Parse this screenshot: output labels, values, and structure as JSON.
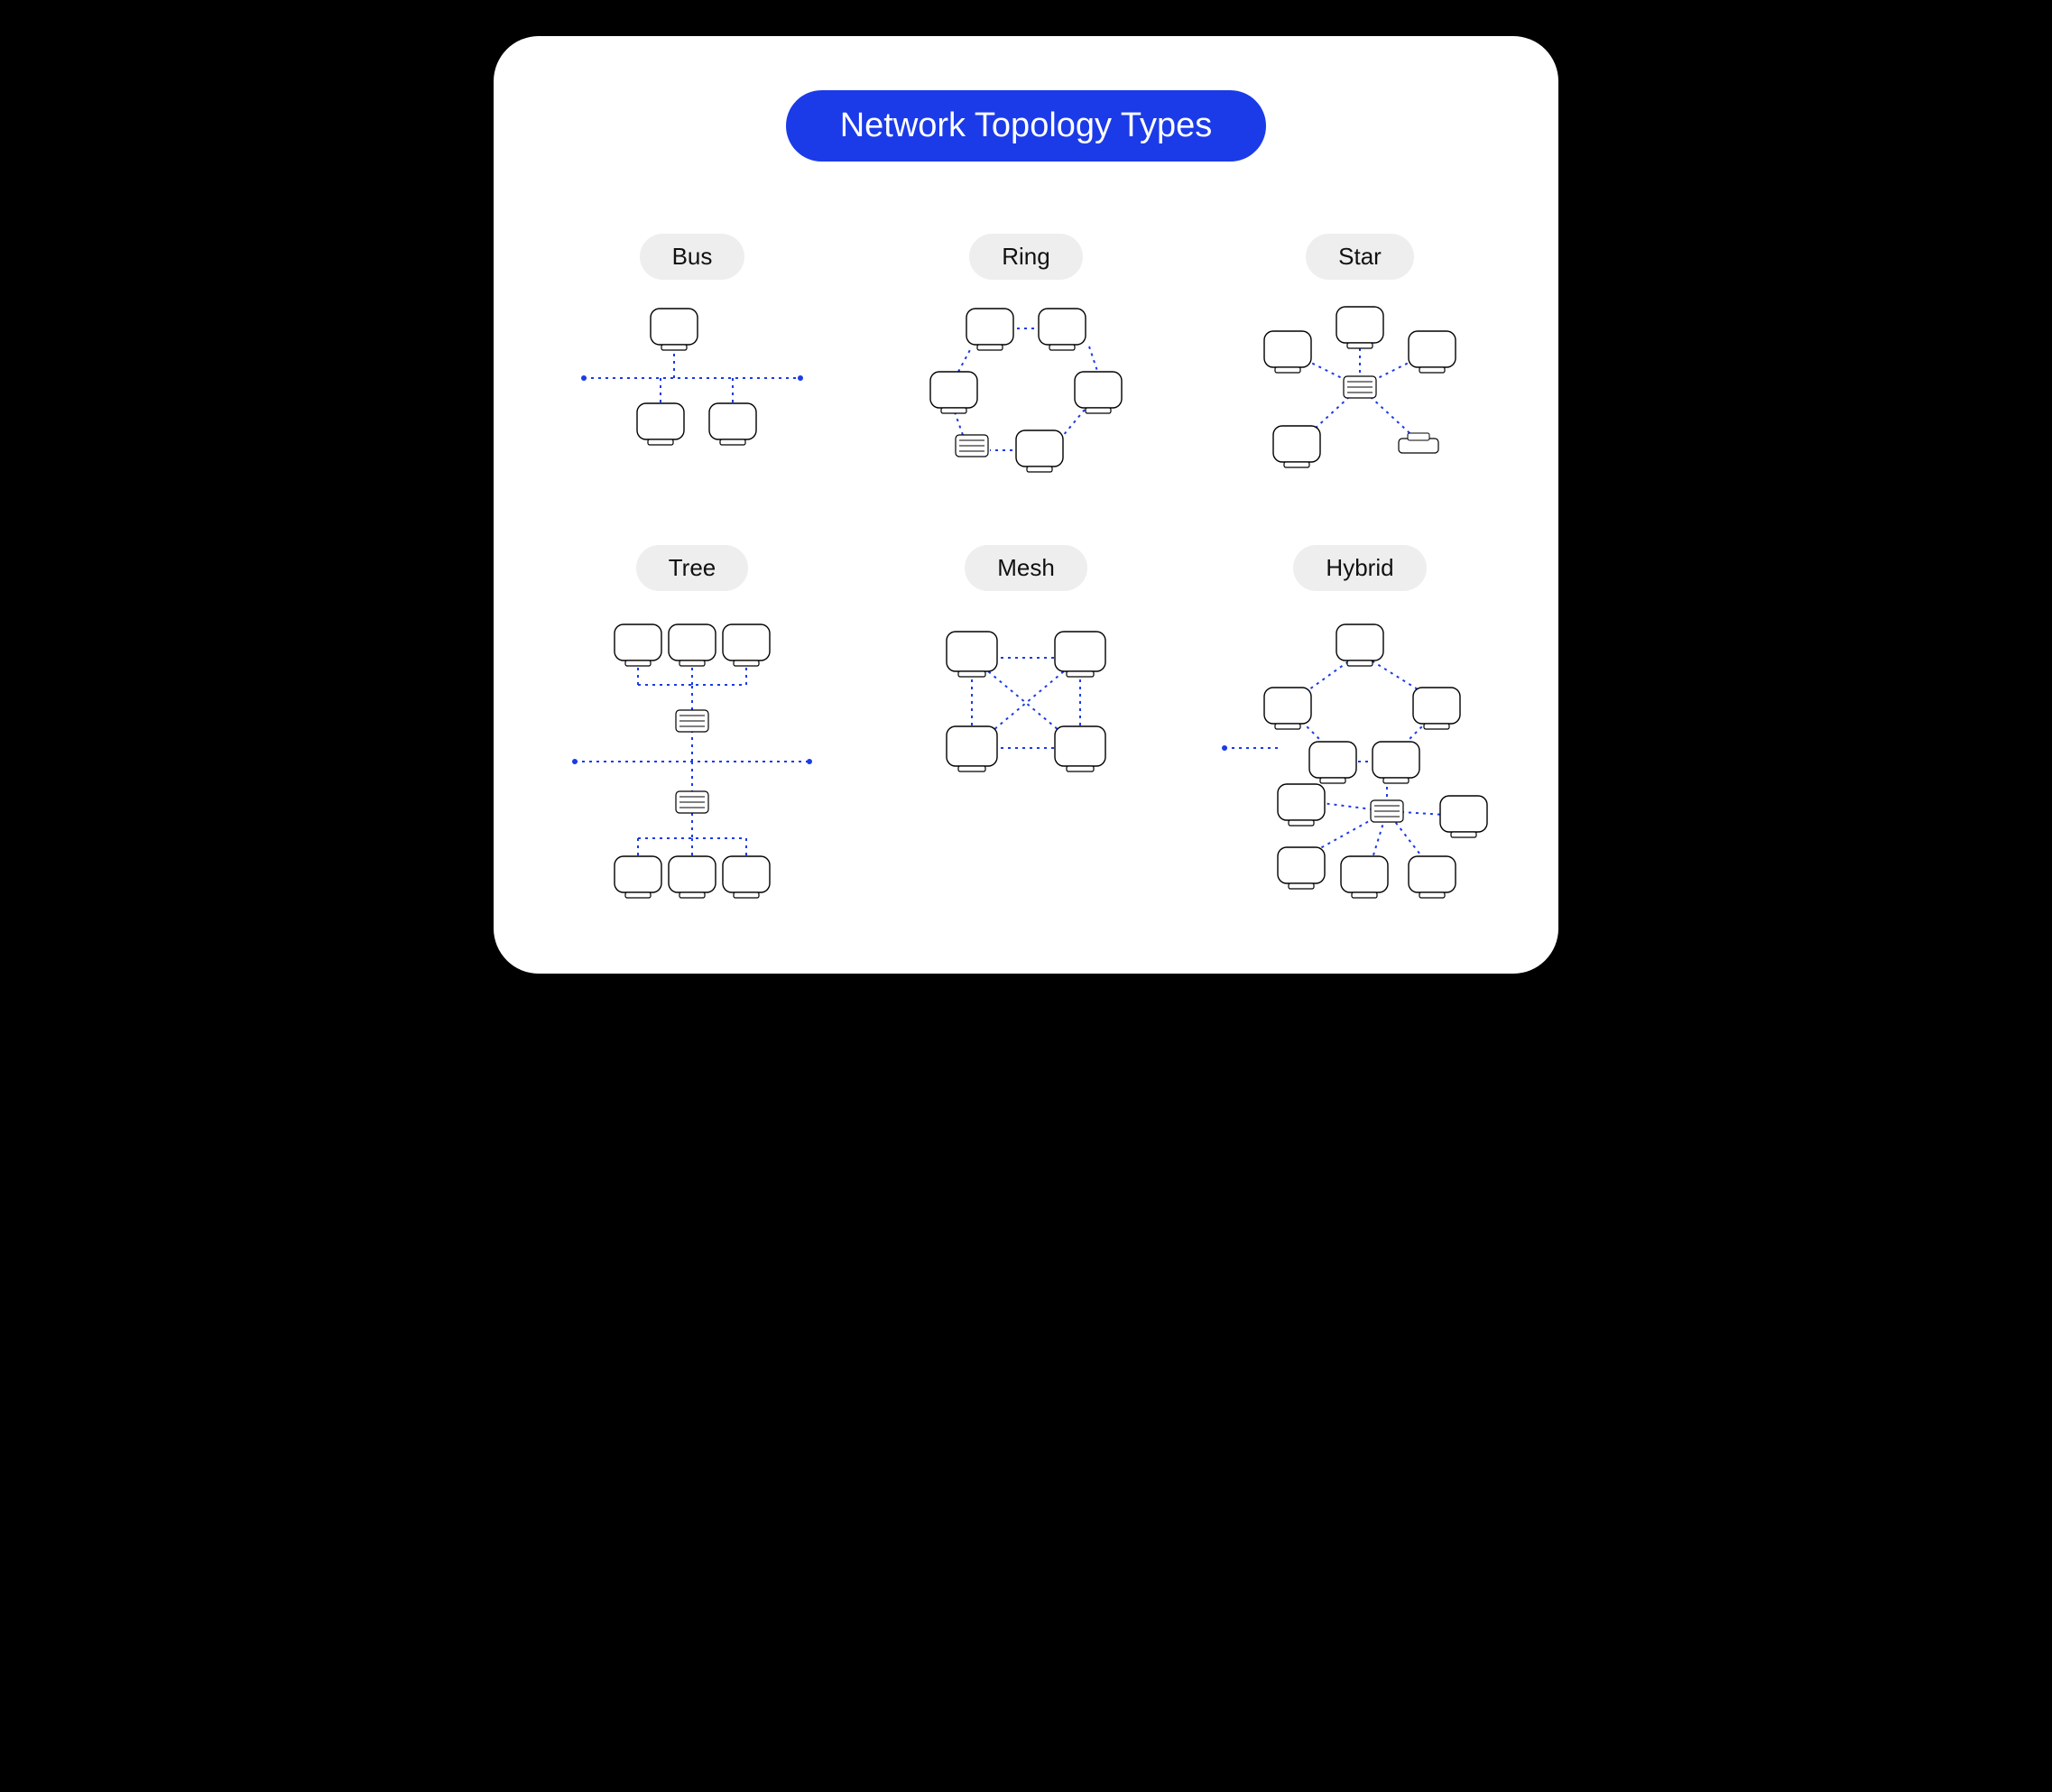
{
  "title": "Network Topology Types",
  "topologies": [
    {
      "id": "bus",
      "label": "Bus"
    },
    {
      "id": "ring",
      "label": "Ring"
    },
    {
      "id": "star",
      "label": "Star"
    },
    {
      "id": "tree",
      "label": "Tree"
    },
    {
      "id": "mesh",
      "label": "Mesh"
    },
    {
      "id": "hybrid",
      "label": "Hybrid"
    }
  ],
  "colors": {
    "accent": "#1b3be8",
    "pill_bg": "#eeeeee",
    "stroke": "#000000",
    "link": "#1b3be8"
  }
}
